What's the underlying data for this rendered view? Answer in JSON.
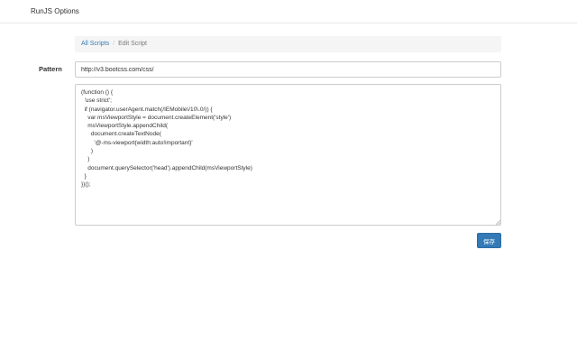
{
  "navbar": {
    "brand": "RunJS Options"
  },
  "breadcrumb": {
    "items": [
      {
        "label": "All Scripts",
        "active": false
      },
      {
        "label": "Edit Script",
        "active": true
      }
    ],
    "separator": "/"
  },
  "form": {
    "pattern_label": "Pattern",
    "pattern_value": "http://v3.bootcss.com/css/",
    "script_value": "(function () {\n  'use strict';\n  if (navigator.userAgent.match(/IEMobile\\/10\\.0/)) {\n    var msViewportStyle = document.createElement('style')\n    msViewportStyle.appendChild(\n      document.createTextNode(\n        '@-ms-viewport{width:auto!important}'\n      )\n    )\n    document.querySelector('head').appendChild(msViewportStyle)\n  }\n})();",
    "save_label": "保存"
  },
  "colors": {
    "primary": "#337ab7",
    "link": "#337ab7",
    "breadcrumb_bg": "#f5f5f5"
  }
}
